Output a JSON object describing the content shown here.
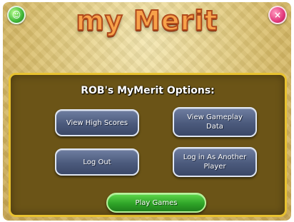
{
  "header": {
    "logo_text": "my Merit",
    "left_button_icon": "smiley-icon",
    "left_button_glyph": "☺",
    "right_button_icon": "close-icon",
    "right_button_glyph": "×"
  },
  "panel": {
    "title": "ROB's MyMerit Options:",
    "buttons": [
      {
        "label": "View High Scores"
      },
      {
        "label": "View Gameplay Data"
      },
      {
        "label": "Log Out"
      },
      {
        "label": "Log in As Another Player"
      }
    ],
    "play_label": "Play Games"
  },
  "colors": {
    "panel_bg": "#6b5417",
    "panel_border": "#e8c230",
    "logo_fill": "#f7a24a",
    "option_button": "#4b5a7c",
    "play_button": "#2fa428"
  }
}
